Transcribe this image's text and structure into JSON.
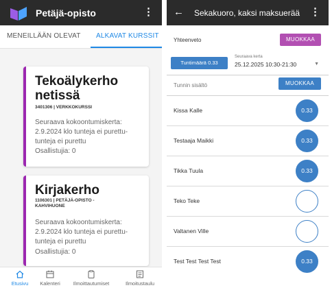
{
  "left": {
    "app_title": "Petäjä-opisto",
    "menu_icon": "more-vert-icon",
    "tabs": [
      {
        "label": "MENEILLÄÄN OLEVAT",
        "active": false
      },
      {
        "label": "ALKAVAT KURSSIT",
        "active": true
      }
    ],
    "cards": [
      {
        "title_line1": "Tekoälykerho",
        "title_line2": "netissä",
        "code_line1": "3401306 | VERKKOKURSSI",
        "code_line2": "",
        "next_line1": "Seuraava kokoontumiskerta:",
        "next_line2": "2.9.2024 klo tunteja ei purettu-",
        "next_line3": "tunteja ei purettu",
        "count": "Osallistujia: 0"
      },
      {
        "title_line1": "Kirjakerho",
        "title_line2": "",
        "code_line1": "1106301 | PETÄJÄ-OPISTO -",
        "code_line2": "KAHVIHUONE",
        "next_line1": "Seuraava kokoontumiskerta:",
        "next_line2": "2.9.2024 klo tunteja ei purettu-",
        "next_line3": "tunteja ei purettu",
        "count": "Osallistujia: 0"
      }
    ],
    "bottom_nav": [
      {
        "label": "Etusivu",
        "icon": "home-icon",
        "active": true
      },
      {
        "label": "Kalenteri",
        "icon": "calendar-icon",
        "active": false
      },
      {
        "label": "Ilmoittautumiset",
        "icon": "clipboard-icon",
        "active": false
      },
      {
        "label": "Ilmoitustaulu",
        "icon": "noticeboard-icon",
        "active": false
      }
    ],
    "accent_color": "#9c27b0",
    "tab_color": "#1e88e5"
  },
  "right": {
    "title": "Sekakuoro, kaksi maksuerää",
    "back_icon": "arrow-back-icon",
    "menu_icon": "more-vert-icon",
    "row1_label": "Yhteenveto",
    "row1_button": "MUOKKAA",
    "session_button": "Tuntimäärä 0.33",
    "dropdown_label": "Seuraava kerta",
    "dropdown_value": "25.12.2025 10:30-21:30",
    "row3_label": "Tunnin sisältö",
    "row3_button": "MUOKKAA",
    "members": [
      {
        "name": "Kissa Kalle",
        "value": "0.33",
        "filled": true
      },
      {
        "name": "Testaaja Maikki",
        "value": "0.33",
        "filled": true
      },
      {
        "name": "Tikka Tuula",
        "value": "0.33",
        "filled": true
      },
      {
        "name": "Teko Teke",
        "value": "",
        "filled": false
      },
      {
        "name": "Valtanen Ville",
        "value": "",
        "filled": false
      },
      {
        "name": "Test Test Test Test",
        "value": "0.33",
        "filled": true
      }
    ],
    "primary_color": "#3d80c6",
    "purple_color": "#b24fb2"
  }
}
